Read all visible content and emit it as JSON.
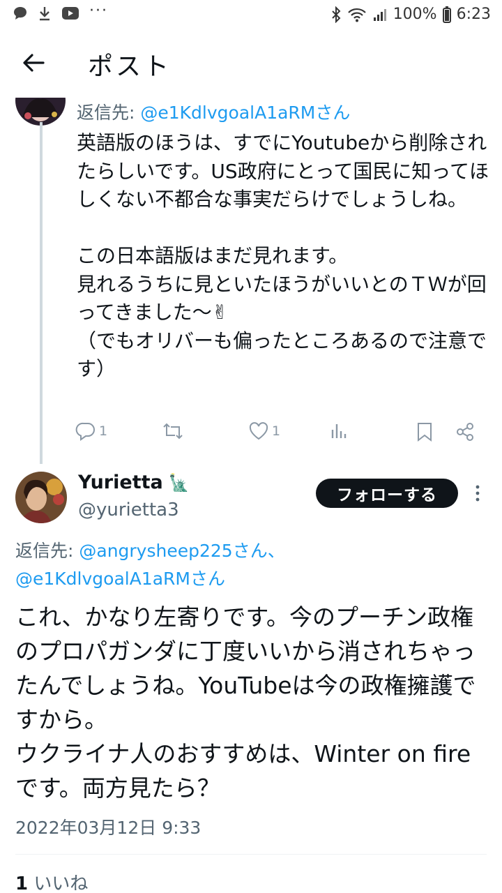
{
  "status_bar": {
    "battery": "100%",
    "time": "6:23",
    "dots": "···"
  },
  "header": {
    "title": "ポスト"
  },
  "parent_tweet": {
    "reply_prefix": "返信先: ",
    "reply_mention": "@e1KdlvgoalA1aRMさん",
    "body": "英語版のほうは、すでにYoutubeから削除されたらしいです。US政府にとって国民に知ってほしくない不都合な事実だらけでしょうしね。\n\nこの日本語版はまだ見れます。\n見れるうちに見といたほうがいいとのＴＷが回ってきました〜✌\n（でもオリバーも偏ったところあるので注意です）",
    "reply_count": "1",
    "like_count": "1"
  },
  "tweet": {
    "name": "Yurietta",
    "name_emoji": "🗽",
    "handle": "@yurietta3",
    "follow_label": "フォローする",
    "reply_prefix": "返信先: ",
    "reply_mention_1": "@angrysheep225さん、",
    "reply_mention_2": "@e1KdlvgoalA1aRMさん",
    "body": "これ、かなり左寄りです。今のプーチン政権のプロパガンダに丁度いいから消されちゃったんでしょうね。YouTubeは今の政権擁護ですから。\nウクライナ人のおすすめは、Winter on fire です。両方見たら？",
    "timestamp": "2022年03月12日 9:33",
    "likes_count": "1",
    "likes_label": " いいね"
  },
  "colors": {
    "accent": "#1d9bf0",
    "text": "#0f1419",
    "muted": "#536471",
    "thread_line": "#cfd9de"
  }
}
